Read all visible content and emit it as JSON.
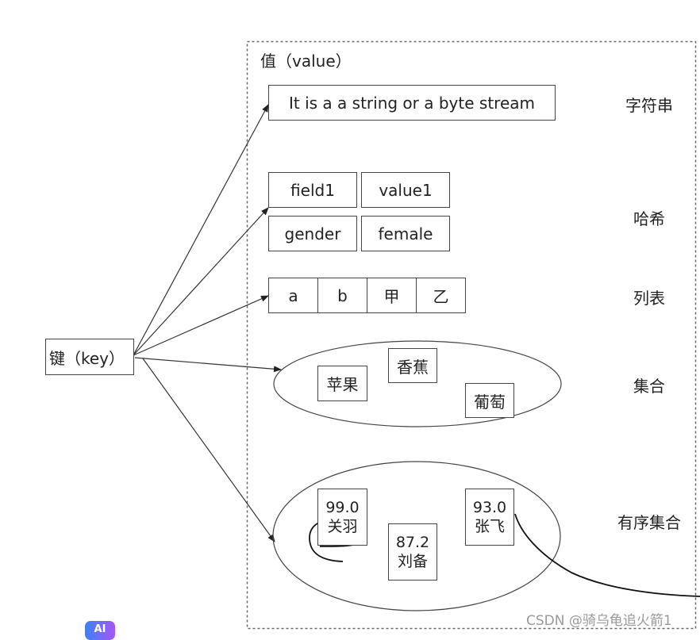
{
  "diagram": {
    "key_label": "键（key）",
    "value_container_label": "值（value）",
    "types": [
      {
        "name": "string",
        "label": "字符串"
      },
      {
        "name": "hash",
        "label": "哈希"
      },
      {
        "name": "list",
        "label": "列表"
      },
      {
        "name": "set",
        "label": "集合"
      },
      {
        "name": "sorted_set",
        "label": "有序集合"
      }
    ],
    "string": {
      "value": "It is a a string or a byte stream"
    },
    "hash": {
      "rows": [
        {
          "field": "field1",
          "value": "value1"
        },
        {
          "field": "gender",
          "value": "female"
        }
      ]
    },
    "list": {
      "items": [
        "a",
        "b",
        "甲",
        "乙"
      ]
    },
    "set": {
      "members": [
        "苹果",
        "香蕉",
        "葡萄"
      ]
    },
    "sorted_set": {
      "members": [
        {
          "score": "99.0",
          "name": "关羽"
        },
        {
          "score": "87.2",
          "name": "刘备"
        },
        {
          "score": "93.0",
          "name": "张飞"
        }
      ]
    },
    "stroke_color": "#444444",
    "annotation_color": "#111111"
  },
  "watermark": "CSDN @骑乌龟追火箭1",
  "ai_badge": "AI"
}
